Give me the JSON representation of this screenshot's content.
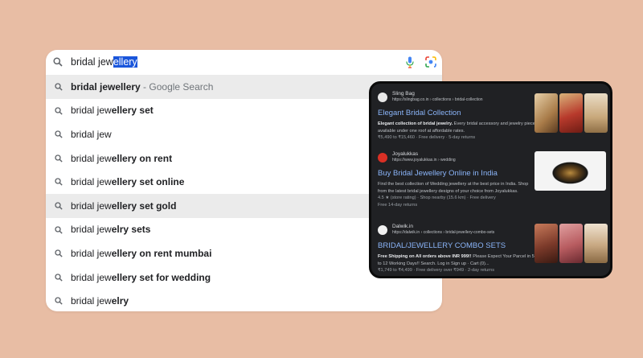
{
  "search": {
    "query_typed": "bridal jew",
    "query_selected": "ellery"
  },
  "suggestions": [
    {
      "bold": "",
      "plain": "bridal jewellery",
      "suffix": " - Google Search",
      "highlighted": true
    },
    {
      "plain": "bridal jew",
      "bold": "ellery set",
      "suffix": "",
      "highlighted": false
    },
    {
      "plain": "bridal jew",
      "bold": "",
      "suffix": "",
      "highlighted": false
    },
    {
      "plain": "bridal jew",
      "bold": "ellery on rent",
      "suffix": "",
      "highlighted": false
    },
    {
      "plain": "bridal jew",
      "bold": "ellery set online",
      "suffix": "",
      "highlighted": false
    },
    {
      "plain": "bridal jew",
      "bold": "ellery set gold",
      "suffix": "",
      "highlighted": true
    },
    {
      "plain": "bridal jew",
      "bold": "elry sets",
      "suffix": "",
      "highlighted": false
    },
    {
      "plain": "bridal jew",
      "bold": "ellery on rent mumbai",
      "suffix": "",
      "highlighted": false
    },
    {
      "plain": "bridal jew",
      "bold": "ellery set for wedding",
      "suffix": "",
      "highlighted": false
    },
    {
      "plain": "bridal jew",
      "bold": "elry",
      "suffix": "",
      "highlighted": false
    }
  ],
  "results": [
    {
      "site_name": "Sling Bag",
      "site_url": "https://slingbag.co.in › collections › bridal-collection",
      "title": "Elegant Bridal Collection",
      "desc_bold": "Elegant collection of bridal jewelry.",
      "desc_rest": " Every bridal accessory and jewelry piece available under one roof at affordable rates.",
      "meta1": "₹5,490 to ₹15,460 · Free delivery · 5-day returns",
      "meta2": "",
      "thumb_colors": [
        "#c9a06a",
        "#b83a2c",
        "#d8c2a2"
      ]
    },
    {
      "site_name": "Joyalukkas",
      "site_url": "https://www.joyalukkas.in › wedding",
      "title": "Buy Bridal Jewellery Online in India",
      "desc_bold": "",
      "desc_rest": "Find the best collection of Wedding jewellery at the best price in India. Shop from the latest bridal jewellery designs of your choice from Joyalukkas.",
      "meta1": "4.5 ★ (store rating) · Shop nearby (15.6 km) · Free delivery",
      "meta2": "Free 14-day returns",
      "thumb_colors": [
        "#f2f2f2",
        "#1c1c1c",
        "#f2f2f2"
      ]
    },
    {
      "site_name": "Dalwik.in",
      "site_url": "https://dalwik.in › collections › bridal-jewellery-combo-sets",
      "title": "BRIDAL/JEWELLERY COMBO SETS",
      "desc_bold": "Free Shipping on All orders above INR 999!!",
      "desc_rest": " Please Expect Your Parcel in 5 to 12 Working Days!! Search. Log in Sign up · Cart (0)...",
      "meta1": "₹1,749 to ₹4,499 · Free delivery over ₹949 · 2-day returns",
      "meta2": "",
      "thumb_colors": [
        "#8a4b3a",
        "#b85c60",
        "#c8a882"
      ]
    }
  ],
  "colors": {
    "background": "#e8bda4",
    "link_blue": "#8ab4f8",
    "selection": "#1a56db"
  }
}
